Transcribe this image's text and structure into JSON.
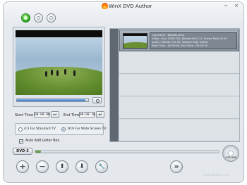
{
  "window": {
    "title": "WinX DVD Author"
  },
  "titlebar_buttons": {
    "minimize_icon": "−",
    "close_icon": "×"
  },
  "time": {
    "start_label": "Start Time :",
    "start_value": "00:00:00",
    "end_label": "End Time :",
    "end_value": "00:00:30",
    "apply_icon": "↵"
  },
  "aspect": {
    "option_43": "4:3 For Standard TV",
    "option_169": "16:9 For Wide Screen TV",
    "selected": "16:9"
  },
  "letterbox": {
    "label": "Auto Add Letter Box",
    "checked": true,
    "check_glyph": "✓"
  },
  "file_list": {
    "items": [
      {
        "lines": [
          "Clip Name : Wildlife.wmv",
          "Video : Size 1280:720, Bitrate 6442.11, Frame Rate 29.00",
          "Audio : Bitrate 192.04, Sample Rate 44100",
          "Start Time : 00:00:00, End Time : 00:00:30"
        ]
      }
    ]
  },
  "disc": {
    "type": "DVD-5",
    "capacity_used_fraction": 0.03,
    "capacity_text": "4380MB"
  },
  "toolbar": {
    "add_icon": "+",
    "remove_icon": "−",
    "move_up_icon": "⬆",
    "move_down_icon": "⬇",
    "settings_icon": "🔧",
    "next_icon": "»"
  },
  "watermark": "www.winxdvd.com",
  "colors": {
    "accent_green": "#3ab72a",
    "selection": "#8f9aa5"
  }
}
